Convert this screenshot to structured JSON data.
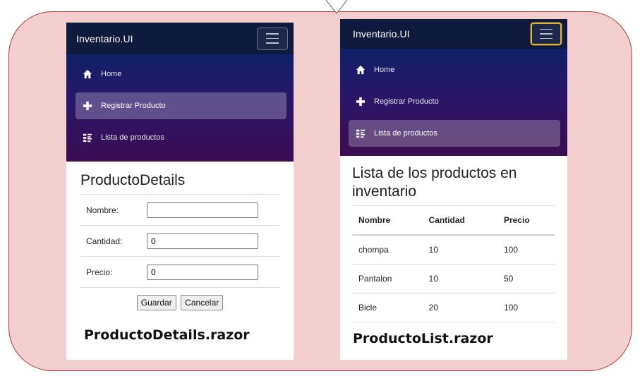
{
  "left_screen": {
    "brand": "Inventario.UI",
    "nav": [
      {
        "label": "Home",
        "icon": "home-icon",
        "active": false
      },
      {
        "label": "Registrar Producto",
        "icon": "plus-icon",
        "active": true
      },
      {
        "label": "Lista de productos",
        "icon": "list-icon",
        "active": false
      }
    ],
    "page_title": "ProductoDetails",
    "form": {
      "nombre_label": "Nombre:",
      "nombre_value": "",
      "cantidad_label": "Cantidad:",
      "cantidad_value": "0",
      "precio_label": "Precio:",
      "precio_value": "0",
      "save_label": "Guardar",
      "cancel_label": "Cancelar"
    },
    "caption": "ProductoDetails.razor"
  },
  "right_screen": {
    "brand": "Inventario.UI",
    "nav": [
      {
        "label": "Home",
        "icon": "home-icon",
        "active": false
      },
      {
        "label": "Registrar Producto",
        "icon": "plus-icon",
        "active": false
      },
      {
        "label": "Lista de productos",
        "icon": "list-icon",
        "active": true
      }
    ],
    "page_title": "Lista de los productos en inventario",
    "table": {
      "headers": [
        "Nombre",
        "Cantidad",
        "Precio"
      ],
      "rows": [
        [
          "chompa",
          "10",
          "100"
        ],
        [
          "Pantalon",
          "10",
          "50"
        ],
        [
          "Bicle",
          "20",
          "100"
        ]
      ]
    },
    "caption": "ProductoList.razor"
  },
  "colors": {
    "callout_fill": "#f3cfcf",
    "callout_border": "#b23a3a",
    "topbar": "#0e1a3e",
    "sidebar_gradient_end": "#3b0d52",
    "toggler_focus": "#e0b23b"
  }
}
